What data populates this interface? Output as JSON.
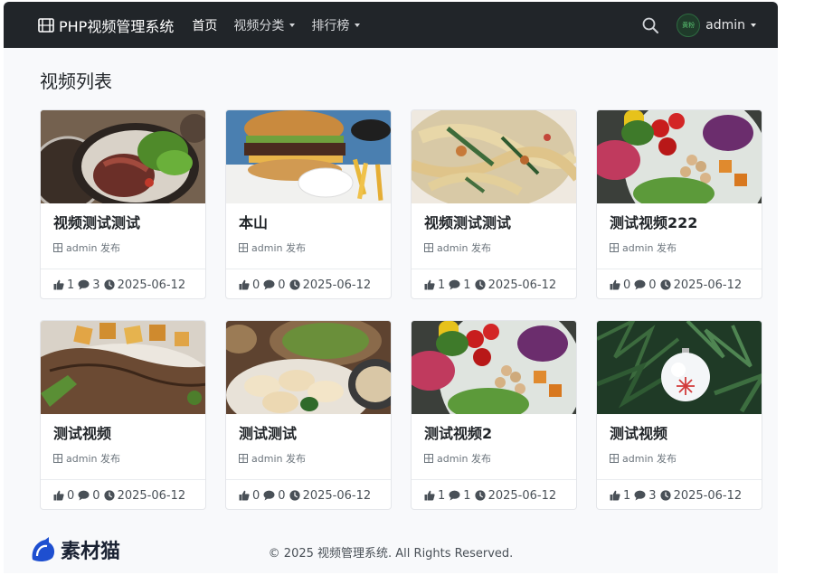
{
  "navbar": {
    "brand": "PHP视频管理系统",
    "links": [
      {
        "label": "首页",
        "active": true
      },
      {
        "label": "视频分类",
        "dropdown": true
      },
      {
        "label": "排行榜",
        "dropdown": true
      }
    ],
    "avatar_text": "黄粉",
    "user": "admin"
  },
  "page_title": "视频列表",
  "videos": [
    {
      "title": "视频测试测试",
      "author": "admin 发布",
      "likes": "1",
      "comments": "3",
      "date": "2025-06-12",
      "thumb": "steak-salad"
    },
    {
      "title": "本山",
      "author": "admin 发布",
      "likes": "0",
      "comments": "0",
      "date": "2025-06-12",
      "thumb": "burger-fries"
    },
    {
      "title": "视频测试测试",
      "author": "admin 发布",
      "likes": "1",
      "comments": "1",
      "date": "2025-06-12",
      "thumb": "pasta"
    },
    {
      "title": "测试视频222",
      "author": "admin 发布",
      "likes": "0",
      "comments": "0",
      "date": "2025-06-12",
      "thumb": "veggie-bowl"
    },
    {
      "title": "测试视频",
      "author": "admin 发布",
      "likes": "0",
      "comments": "0",
      "date": "2025-06-12",
      "thumb": "grilled-meat"
    },
    {
      "title": "测试测试",
      "author": "admin 发布",
      "likes": "0",
      "comments": "0",
      "date": "2025-06-12",
      "thumb": "dumplings"
    },
    {
      "title": "测试视频2",
      "author": "admin 发布",
      "likes": "1",
      "comments": "1",
      "date": "2025-06-12",
      "thumb": "veggie-bowl"
    },
    {
      "title": "测试视频",
      "author": "admin 发布",
      "likes": "1",
      "comments": "3",
      "date": "2025-06-12",
      "thumb": "christmas-ornament"
    }
  ],
  "footer": "© 2025 视频管理系统. All Rights Reserved.",
  "watermark": "素材猫",
  "colors": {
    "navbar": "#212529",
    "page_bg": "#f8f9fb",
    "card_border": "#e4e6ea",
    "text": "#212529",
    "muted": "#6c757d"
  }
}
